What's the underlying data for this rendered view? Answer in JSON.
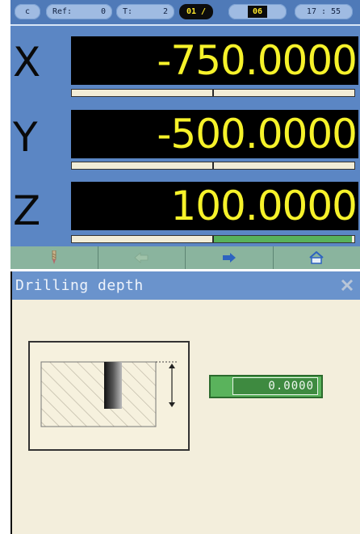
{
  "status_bar": {
    "mode": "c",
    "ref_label": "Ref:",
    "ref_value": "0",
    "tool_label": "T:",
    "tool_value": "2",
    "chip_one": "01 /",
    "chip_two": "06",
    "clock": "17 : 55"
  },
  "axes": [
    {
      "letter": "X",
      "value": "-750.0000",
      "bar_fill": 0.0
    },
    {
      "letter": "Y",
      "value": "-500.0000",
      "bar_fill": 0.0
    },
    {
      "letter": "Z",
      "value": "100.0000",
      "bar_fill": 0.49
    }
  ],
  "softkeys": [
    {
      "icon": "drill-bit-icon"
    },
    {
      "icon": "arrow-left-icon"
    },
    {
      "icon": "arrow-right-icon"
    },
    {
      "icon": "home-icon"
    }
  ],
  "dialog": {
    "title": "Drilling depth",
    "close_icon": "close-icon",
    "depth_value": "0.0000"
  },
  "colors": {
    "panel_blue": "#5b86c4",
    "readout_yellow": "#f6f22a",
    "bar_green": "#58b15a",
    "dialog_bg": "#f3eedc",
    "input_green": "#5ab35c"
  }
}
